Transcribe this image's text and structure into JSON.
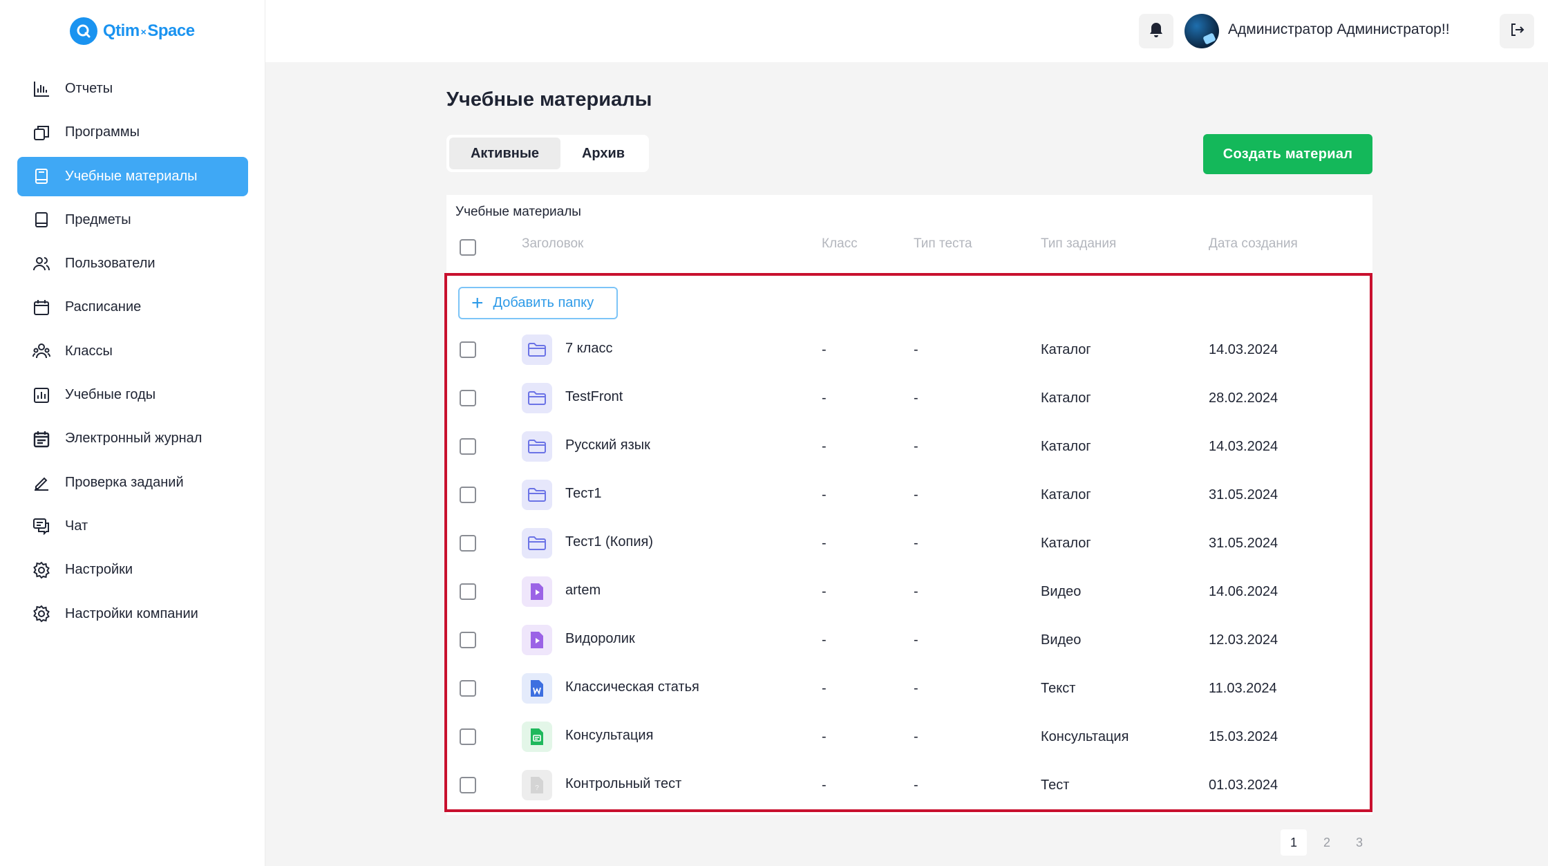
{
  "brand": {
    "name_left": "Qtim",
    "separator": "×",
    "name_right": "Space",
    "color": "#1a93f0"
  },
  "sidebar": {
    "items": [
      {
        "label": "Отчеты",
        "icon": "bar-chart-icon",
        "active": false
      },
      {
        "label": "Программы",
        "icon": "copy-stack-icon",
        "active": false
      },
      {
        "label": "Учебные материалы",
        "icon": "book-icon",
        "active": true
      },
      {
        "label": "Предметы",
        "icon": "book-icon",
        "active": false
      },
      {
        "label": "Пользователи",
        "icon": "users-icon",
        "active": false
      },
      {
        "label": "Расписание",
        "icon": "calendar-icon",
        "active": false
      },
      {
        "label": "Классы",
        "icon": "class-group-icon",
        "active": false
      },
      {
        "label": "Учебные годы",
        "icon": "chart-box-icon",
        "active": false
      },
      {
        "label": "Электронный журнал",
        "icon": "journal-calendar-icon",
        "active": false
      },
      {
        "label": "Проверка заданий",
        "icon": "pencil-icon",
        "active": false
      },
      {
        "label": "Чат",
        "icon": "chat-icon",
        "active": false
      },
      {
        "label": "Настройки",
        "icon": "gear-icon",
        "active": false
      },
      {
        "label": "Настройки компании",
        "icon": "gear-icon",
        "active": false
      }
    ]
  },
  "header": {
    "user_name": "Администратор Администратор!!",
    "bell_icon": "bell-icon",
    "logout_icon": "logout-icon"
  },
  "main": {
    "title": "Учебные материалы",
    "tabs": [
      {
        "label": "Активные",
        "active": true
      },
      {
        "label": "Архив",
        "active": false
      }
    ],
    "create_button": "Создать материал",
    "card_title": "Учебные материалы",
    "columns": {
      "title": "Заголовок",
      "grade": "Класс",
      "test_type": "Тип теста",
      "task_type": "Тип задания",
      "created": "Дата создания"
    },
    "add_folder_label": "Добавить папку",
    "rows": [
      {
        "name": "7 класс",
        "grade": "-",
        "test_type": "-",
        "task_type": "Каталог",
        "created": "14.03.2024",
        "icon": "folder-icon"
      },
      {
        "name": "TestFront",
        "grade": "-",
        "test_type": "-",
        "task_type": "Каталог",
        "created": "28.02.2024",
        "icon": "folder-icon"
      },
      {
        "name": "Русский язык",
        "grade": "-",
        "test_type": "-",
        "task_type": "Каталог",
        "created": "14.03.2024",
        "icon": "folder-icon"
      },
      {
        "name": "Тест1",
        "grade": "-",
        "test_type": "-",
        "task_type": "Каталог",
        "created": "31.05.2024",
        "icon": "folder-icon"
      },
      {
        "name": "Тест1 (Копия)",
        "grade": "-",
        "test_type": "-",
        "task_type": "Каталог",
        "created": "31.05.2024",
        "icon": "folder-icon"
      },
      {
        "name": "artem",
        "grade": "-",
        "test_type": "-",
        "task_type": "Видео",
        "created": "14.06.2024",
        "icon": "video-file-icon"
      },
      {
        "name": "Видоролик",
        "grade": "-",
        "test_type": "-",
        "task_type": "Видео",
        "created": "12.03.2024",
        "icon": "video-file-icon"
      },
      {
        "name": "Классическая статья",
        "grade": "-",
        "test_type": "-",
        "task_type": "Текст",
        "created": "11.03.2024",
        "icon": "word-doc-icon"
      },
      {
        "name": "Консультация",
        "grade": "-",
        "test_type": "-",
        "task_type": "Консультация",
        "created": "15.03.2024",
        "icon": "consultation-file-icon"
      },
      {
        "name": "Контрольный тест",
        "grade": "-",
        "test_type": "-",
        "task_type": "Тест",
        "created": "01.03.2024",
        "icon": "test-file-icon"
      }
    ],
    "pagination": {
      "pages": [
        "1",
        "2",
        "3"
      ],
      "current": "1"
    }
  },
  "colors": {
    "accent": "#3fa8f5",
    "create_button": "#14b85a",
    "highlight_border": "#c8102e",
    "add_folder_text": "#2f9be8"
  }
}
